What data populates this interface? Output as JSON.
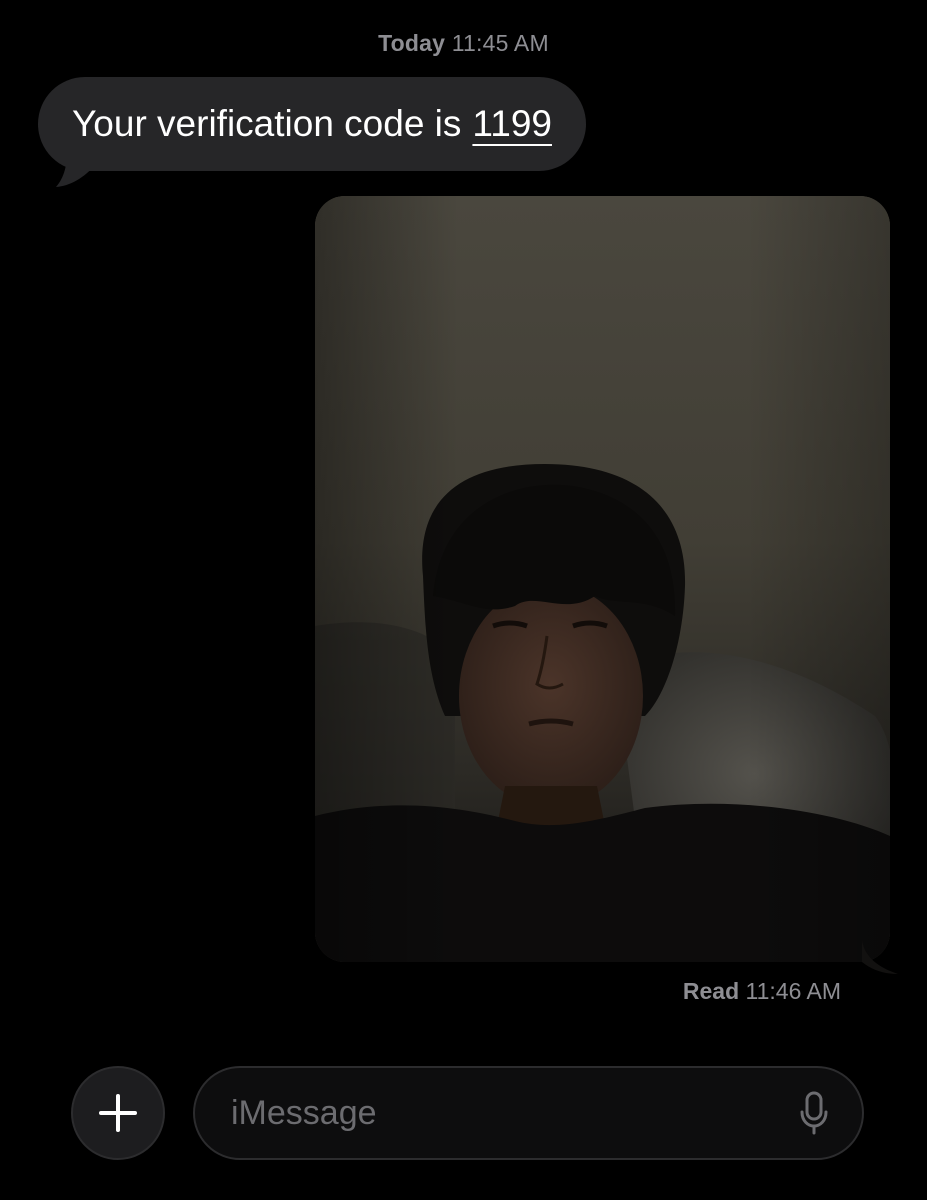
{
  "conversation": {
    "timestamp_day": "Today",
    "timestamp_time": "11:45 AM",
    "incoming_message": {
      "text": "Your verification code is",
      "code": "1199"
    },
    "outgoing_photo": {
      "description_icon": "photo-attachment"
    },
    "read_receipt": {
      "label": "Read",
      "time": "11:46 AM"
    }
  },
  "composer": {
    "plus_icon": "plus-icon",
    "placeholder": "iMessage",
    "mic_icon": "microphone-icon"
  },
  "colors": {
    "background": "#000000",
    "incoming_bubble": "#262628",
    "secondary_text": "#8e8e93",
    "input_border": "#2c2c2e"
  }
}
